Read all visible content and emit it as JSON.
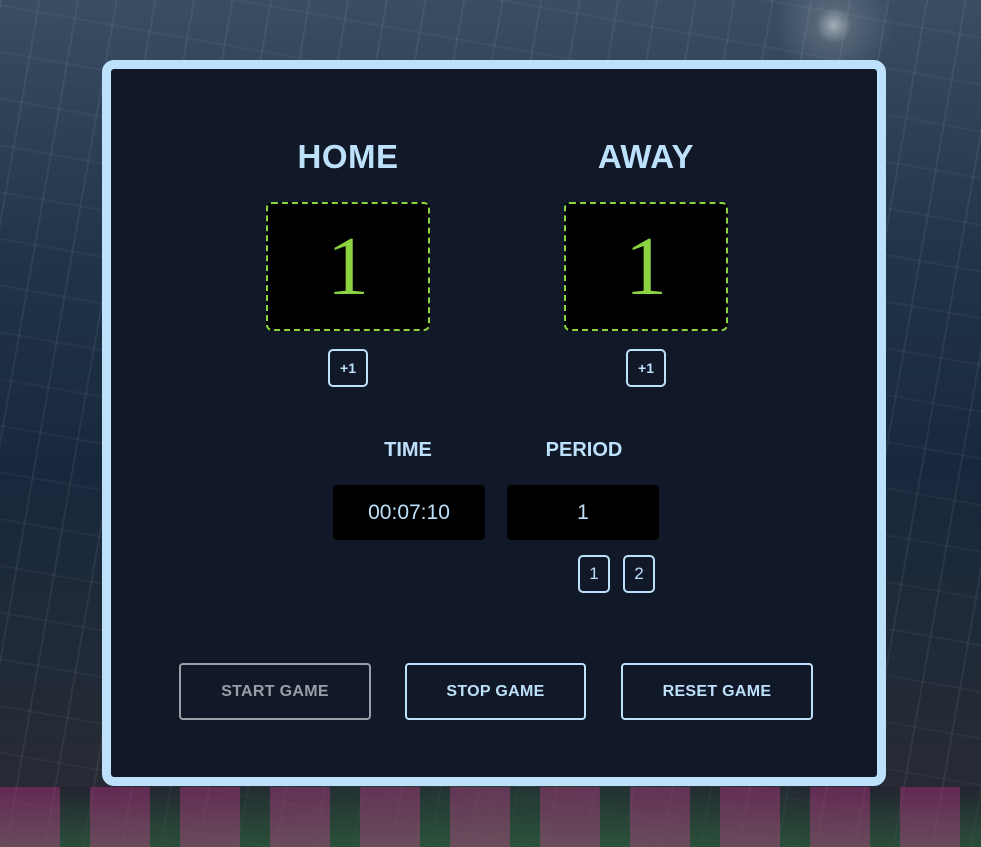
{
  "teams": {
    "home": {
      "name": "HOME",
      "score": "1",
      "increment_label": "+1"
    },
    "away": {
      "name": "AWAY",
      "score": "1",
      "increment_label": "+1"
    }
  },
  "clock": {
    "time_label": "TIME",
    "time_value": "00:07:10",
    "period_label": "PERIOD",
    "period_value": "1",
    "period_options": [
      "1",
      "2"
    ]
  },
  "controls": {
    "start_label": "START GAME",
    "stop_label": "STOP GAME",
    "reset_label": "RESET GAME",
    "start_disabled": true
  },
  "colors": {
    "panel_background": "#111827",
    "panel_border": "#bde0fb",
    "accent_text": "#bde0fb",
    "score_green": "#8bd341",
    "disabled_gray": "#9a9ea6"
  }
}
